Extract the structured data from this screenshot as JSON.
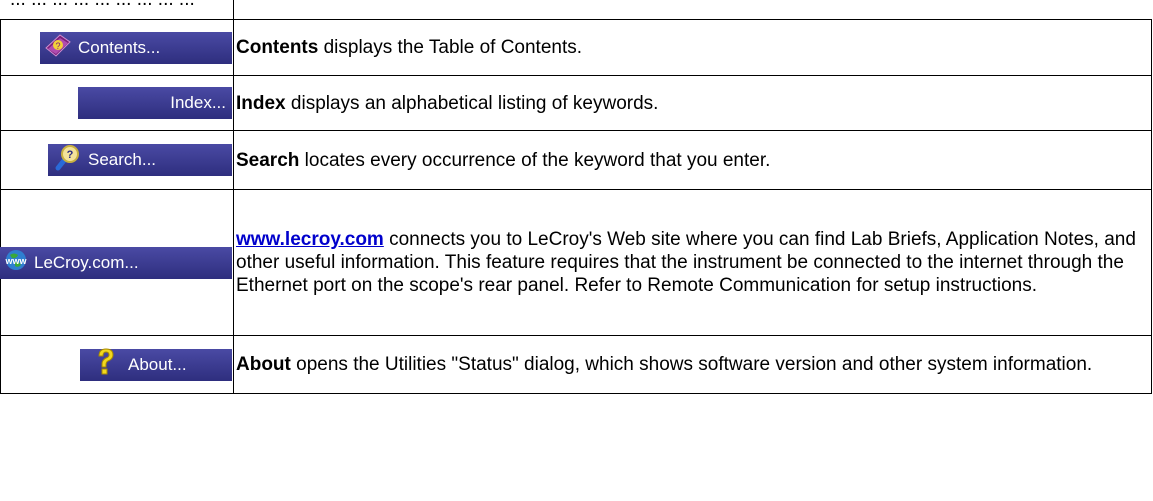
{
  "intro_text": "... ...        ...   ...    ... ...    ...     ...      ...",
  "rows": [
    {
      "button_label": "Contents...",
      "icon": "help-book-icon",
      "term": "Contents",
      "text": " displays the Table of Contents."
    },
    {
      "button_label": "Index...",
      "icon": "",
      "term": "Index",
      "text": " displays an alphabetical listing of keywords."
    },
    {
      "button_label": "Search...",
      "icon": "magnifier-question-icon",
      "term": "Search",
      "text": " locates every occurrence of the keyword that you enter."
    },
    {
      "button_label": "LeCroy.com...",
      "icon": "www-globe-icon",
      "term": "www.lecroy.com",
      "text": " connects you to LeCroy's Web site where you can find Lab Briefs, Application Notes, and other useful information. This feature requires that the instrument be connected to the internet through the Ethernet port on the scope's rear panel. Refer to Remote Communication for setup instructions."
    },
    {
      "button_label": "About...",
      "icon": "question-mark-icon",
      "term": "About",
      "text": " opens the Utilities \"Status\" dialog, which shows software version and other system information."
    }
  ],
  "colors": {
    "button_bg": "#38388c",
    "button_text": "#ffffff",
    "link": "#0000cc"
  }
}
